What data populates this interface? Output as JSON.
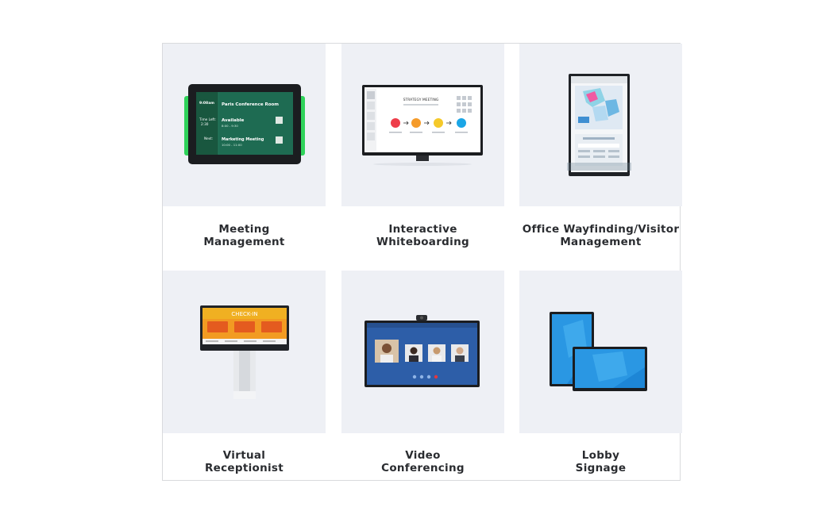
{
  "cards": [
    {
      "title": "Meeting\nManagement",
      "screen": {
        "time": "9:08am",
        "room": "Paris Conference Room",
        "time_left_label": "Time Left:",
        "time_left_value": "2:30",
        "status": "Available",
        "status_time": "8:00 - 9:30",
        "next_label": "Next:",
        "next_meeting": "Marketing Meeting",
        "next_time": "10:00 - 11:00"
      }
    },
    {
      "title": "Interactive\nWhiteboarding",
      "screen": {
        "heading": "STRATEGY MEETING"
      }
    },
    {
      "title": "Office Wayfinding/Visitor\nManagement",
      "screen": {}
    },
    {
      "title": "Virtual\nReceptionist",
      "screen": {
        "heading": "CHECK-IN"
      }
    },
    {
      "title": "Video\nConferencing",
      "screen": {}
    },
    {
      "title": "Lobby\nSignage",
      "screen": {}
    }
  ],
  "colors": {
    "image_bg": "#eef0f5",
    "title_text": "#2a2c30",
    "frame_border": "#d9dadd",
    "accent_green": "#2fd35a",
    "screen_teal": "#1e6b52",
    "kiosk_orange": "#f29b22",
    "display_blue": "#1d86d6"
  }
}
